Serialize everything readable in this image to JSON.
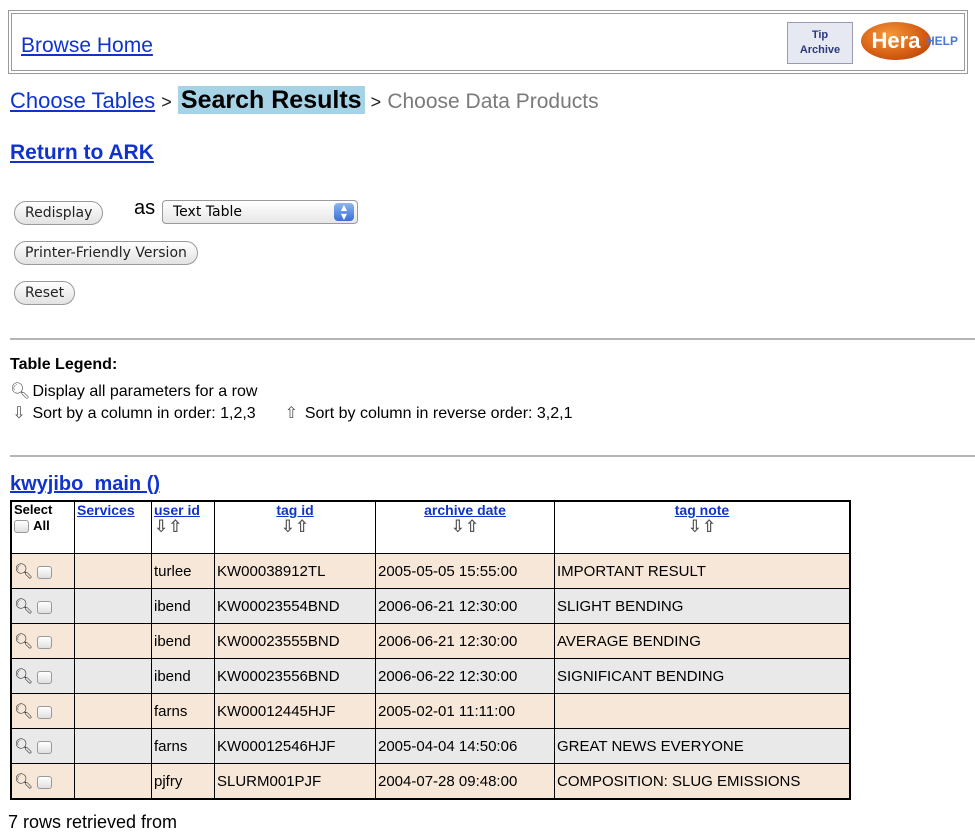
{
  "header": {
    "browse_home": "Browse Home",
    "tip_archive_line1": "Tip",
    "tip_archive_line2": "Archive",
    "hera_logo": "Hera",
    "help": "HELP"
  },
  "breadcrumb": {
    "step1": "Choose Tables",
    "sep": ">",
    "current": "Search Results",
    "step3": "Choose Data Products"
  },
  "return_link": "Return to ARK",
  "controls": {
    "redisplay_label": "Redisplay",
    "as_label": "as",
    "format_selected": "Text Table",
    "printer_label": "Printer-Friendly Version",
    "reset_label": "Reset"
  },
  "legend": {
    "title": "Table Legend:",
    "display_row": "Display all parameters for a row",
    "sort_asc": "Sort by a column in order: 1,2,3",
    "sort_desc": "Sort by column in reverse order: 3,2,1"
  },
  "table": {
    "title": "kwyjibo_main ()",
    "headers": {
      "select": "Select",
      "all": "All",
      "services": "Services",
      "user_id": "user id",
      "tag_id": "tag id",
      "archive_date": "archive date",
      "tag_note": "tag note"
    },
    "rows": [
      {
        "user": "turlee",
        "tag": "KW00038912TL",
        "date": "2005-05-05 15:55:00",
        "note": "IMPORTANT RESULT"
      },
      {
        "user": "ibend",
        "tag": "KW00023554BND",
        "date": "2006-06-21 12:30:00",
        "note": "SLIGHT BENDING"
      },
      {
        "user": "ibend",
        "tag": "KW00023555BND",
        "date": "2006-06-21 12:30:00",
        "note": "AVERAGE BENDING"
      },
      {
        "user": "ibend",
        "tag": "KW00023556BND",
        "date": "2006-06-22 12:30:00",
        "note": "SIGNIFICANT BENDING"
      },
      {
        "user": "farns",
        "tag": "KW00012445HJF",
        "date": "2005-02-01 11:11:00",
        "note": ""
      },
      {
        "user": "farns",
        "tag": "KW00012546HJF",
        "date": "2005-04-04 14:50:06",
        "note": "GREAT NEWS EVERYONE"
      },
      {
        "user": "pjfry",
        "tag": "SLURM001PJF",
        "date": "2004-07-28 09:48:00",
        "note": "COMPOSITION: SLUG EMISSIONS"
      }
    ]
  },
  "status": "7 rows retrieved from",
  "icons": {
    "magnifier": "magnifier-icon",
    "sort_down": "arrow-down-icon",
    "sort_up": "arrow-up-icon"
  }
}
